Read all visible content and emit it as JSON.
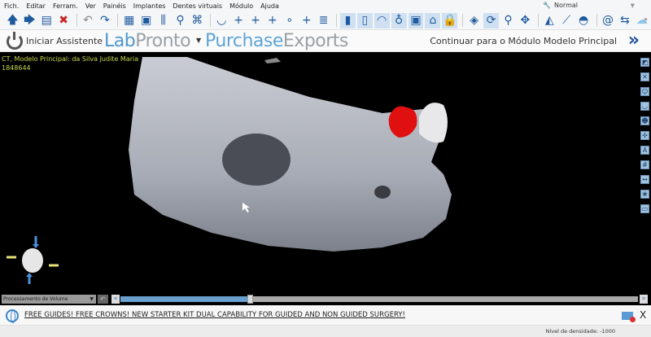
{
  "menu": [
    "Fich.",
    "Editar",
    "Ferram.",
    "Ver",
    "Painéis",
    "Implantes",
    "Dentes virtuais",
    "Módulo",
    "Ajuda"
  ],
  "mode": "Normal",
  "toolbar": [
    {
      "icon": "open-icon",
      "g": "🡅"
    },
    {
      "icon": "export-icon",
      "g": "🡆"
    },
    {
      "icon": "save-icon",
      "g": "▤"
    },
    {
      "icon": "close-file-icon",
      "g": "✖",
      "c": "#c62828"
    },
    {
      "sep": true
    },
    {
      "icon": "undo-icon",
      "g": "↶",
      "c": "#888"
    },
    {
      "icon": "redo-icon",
      "g": "↷"
    },
    {
      "sep": true
    },
    {
      "icon": "layout-icon",
      "g": "▦"
    },
    {
      "icon": "screenshot-icon",
      "g": "▣"
    },
    {
      "icon": "sliders-icon",
      "g": "⫼"
    },
    {
      "icon": "density-search-icon",
      "g": "⚲"
    },
    {
      "icon": "nerve-icon",
      "g": "⌘"
    },
    {
      "sep": true
    },
    {
      "icon": "arch-icon",
      "g": "◡"
    },
    {
      "icon": "add-implant-icon",
      "g": "+"
    },
    {
      "icon": "add-bone-icon",
      "g": "+"
    },
    {
      "icon": "add-tooth-icon",
      "g": "+"
    },
    {
      "icon": "add-anchor-icon",
      "g": "∘"
    },
    {
      "icon": "add-abutment-icon",
      "g": "+"
    },
    {
      "icon": "settings-list-icon",
      "g": "≣"
    },
    {
      "sep": true
    },
    {
      "icon": "implant-icon",
      "g": "▮",
      "hl": true
    },
    {
      "icon": "sleeve-icon",
      "g": "▯",
      "hl": true
    },
    {
      "icon": "gum-icon",
      "g": "◠",
      "hl": true
    },
    {
      "icon": "tooth-icon",
      "g": "♁",
      "hl": true
    },
    {
      "icon": "guide-icon",
      "g": "▣",
      "hl": true
    },
    {
      "icon": "model-icon",
      "g": "⌂",
      "hl": true
    },
    {
      "icon": "lock-icon",
      "g": "🔒",
      "hl": true
    },
    {
      "sep": true
    },
    {
      "icon": "center-icon",
      "g": "◈"
    },
    {
      "icon": "rotate-icon",
      "g": "⟳",
      "hl": true
    },
    {
      "icon": "zoom-icon",
      "g": "⚲"
    },
    {
      "icon": "pan-icon",
      "g": "✥"
    },
    {
      "sep": true
    },
    {
      "icon": "histogram-icon",
      "g": "◭"
    },
    {
      "icon": "ruler-icon",
      "g": "⟋"
    },
    {
      "icon": "protractor-icon",
      "g": "◓"
    },
    {
      "sep": true
    },
    {
      "icon": "spiral-icon",
      "g": "@"
    },
    {
      "icon": "adjust-icon",
      "g": "⇆"
    },
    {
      "icon": "cloud-icon",
      "g": "☁",
      "c": "#8ec3ea"
    }
  ],
  "more": "»",
  "assistant": {
    "label": "Iniciar Assistente",
    "lab_a": "Lab",
    "lab_b": "Pronto",
    "pe_a": "Purchase",
    "pe_b": "Exports",
    "continue": "Continuar para o Módulo Modelo Principal",
    "continue_icon": "»"
  },
  "viewport": {
    "title": "CT, Modelo Principal: da Silva Judite Maria",
    "id": "1848644"
  },
  "side_tools": [
    {
      "icon": "slice-icon",
      "g": "◩"
    },
    {
      "icon": "axes-icon",
      "g": "✕"
    },
    {
      "icon": "skull-icon",
      "g": "☺"
    },
    {
      "icon": "jaw-icon",
      "g": "◡"
    },
    {
      "icon": "face-icon",
      "g": "☻"
    },
    {
      "icon": "orientation-icon",
      "g": "✣"
    },
    {
      "icon": "annotation-icon",
      "g": "A"
    },
    {
      "icon": "grid-icon",
      "g": "#"
    },
    {
      "icon": "measure-icon",
      "g": "↔"
    },
    {
      "icon": "ds-icon",
      "g": "❀"
    },
    {
      "icon": "camera-icon",
      "g": "▭"
    }
  ],
  "volume_select": "Processamento de Volume",
  "slider_value": 0.25,
  "banner": "FREE GUIDES! FREE CROWNS! NEW STARTER KIT DUAL CAPABILITY FOR GUIDED AND NON GUIDED SURGERY!",
  "close": "X",
  "density": "Nível de densidade: -1000"
}
